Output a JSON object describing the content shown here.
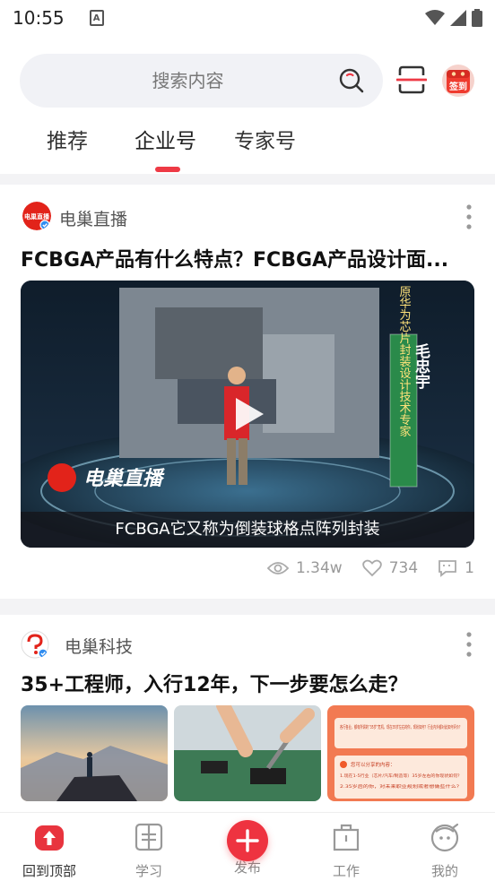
{
  "status_bar": {
    "time": "10:55",
    "notif_letter": "A"
  },
  "search": {
    "placeholder": "搜索内容"
  },
  "sign_in": {
    "label": "签到"
  },
  "tabs": [
    {
      "label": "推荐"
    },
    {
      "label": "企业号"
    },
    {
      "label": "专家号"
    }
  ],
  "active_tab": "企业号",
  "feed": [
    {
      "author": "电巢直播",
      "title": "FCBGA产品有什么特点？FCBGA产品设计面...",
      "video_caption": "FCBGA它又称为倒装球格点阵列封装",
      "video_overlay": {
        "brand": "电巢直播",
        "speaker_name": "毛忠宇",
        "speaker_title": "原华为芯片封装设计技术专家"
      },
      "stats": {
        "views": "1.34w",
        "likes": "734",
        "comments": "1"
      }
    },
    {
      "author": "电巢科技",
      "title": "35+工程师，入行12年，下一步要怎么走？",
      "thumbnail_text": [
        "各行各业，都有所谓的“35岁”危机，现在35岁左右的你，现状如何？行业内外都对此如何评价？",
        "您可以分享的内容：",
        "1.现在1-5行业（芯片/汽车/制造等）35岁左右的你现状如何？",
        "2.35岁后的你，对未来职业规划或者想做些什么？"
      ]
    }
  ],
  "bottom_nav": [
    {
      "label": "回到顶部"
    },
    {
      "label": "学习"
    },
    {
      "label": "发布"
    },
    {
      "label": "工作"
    },
    {
      "label": "我的"
    }
  ],
  "colors": {
    "accent": "#ee3a45",
    "tab_indicator": "#ee3a45",
    "search_bg": "#f1f2f6"
  }
}
